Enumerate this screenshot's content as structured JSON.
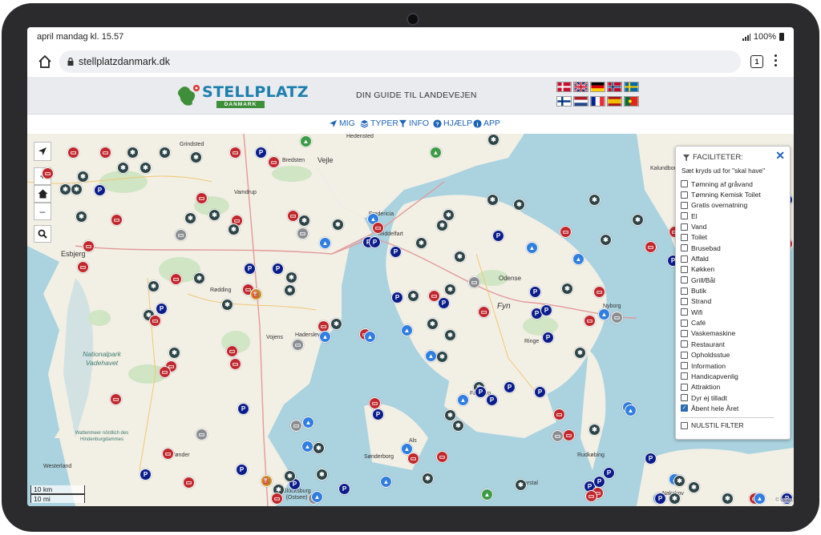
{
  "status": {
    "time": "april mandag kl. 15.57",
    "battery": "100%"
  },
  "browser": {
    "url": "stellplatzdanmark.dk",
    "tab_count": "1"
  },
  "site": {
    "logo_text": "STELLPLATZ",
    "logo_sub": "DANMARK",
    "tagline": "DIN GUIDE TIL LANDEVEJEN"
  },
  "nav": {
    "items": [
      "MIG",
      "TYPER",
      "INFO",
      "HJÆLP",
      "APP"
    ]
  },
  "map": {
    "labels": [
      "Grindsted",
      "Bredsten",
      "Vejle",
      "Fredericia",
      "Esbjerg",
      "Rødding",
      "Odense",
      "Fyn",
      "Nyborg",
      "Vojens",
      "Haderslev",
      "Nationalpark Vadehavet",
      "Wattenmeer nördlich des Hindenburgdammes",
      "Ringe",
      "Faaborg",
      "Als",
      "Sønderborg",
      "Marstal",
      "Rudkøbing",
      "Westerland",
      "Tønder",
      "Glücksburg (Ostsee)",
      "Kalundborg",
      "Nakskov",
      "Hedensted",
      "Vamdrup",
      "Middelfart"
    ],
    "scale": [
      "10 km",
      "10 mi"
    ],
    "attribution": "© OACI"
  },
  "filter": {
    "title": "FACILITETER:",
    "hint": "Sæt kryds ud for \"skal have\"",
    "items": [
      {
        "label": "Tømning af gråvand",
        "checked": false
      },
      {
        "label": "Tømning Kemisk Toilet",
        "checked": false
      },
      {
        "label": "Gratis overnatning",
        "checked": false
      },
      {
        "label": "El",
        "checked": false
      },
      {
        "label": "Vand",
        "checked": false
      },
      {
        "label": "Toilet",
        "checked": false
      },
      {
        "label": "Brusebad",
        "checked": false
      },
      {
        "label": "Affald",
        "checked": false
      },
      {
        "label": "Køkken",
        "checked": false
      },
      {
        "label": "Grill/Bål",
        "checked": false
      },
      {
        "label": "Butik",
        "checked": false
      },
      {
        "label": "Strand",
        "checked": false
      },
      {
        "label": "Wifi",
        "checked": false
      },
      {
        "label": "Café",
        "checked": false
      },
      {
        "label": "Vaskemaskine",
        "checked": false
      },
      {
        "label": "Restaurant",
        "checked": false
      },
      {
        "label": "Opholdsstue",
        "checked": false
      },
      {
        "label": "Information",
        "checked": false
      },
      {
        "label": "Handicapvenlig",
        "checked": false
      },
      {
        "label": "Attraktion",
        "checked": false
      },
      {
        "label": "Dyr ej tilladt",
        "checked": false
      },
      {
        "label": "Åbent hele Året",
        "checked": true
      }
    ],
    "reset": "NULSTIL FILTER"
  },
  "colors": {
    "accent": "#1e63b6",
    "brand": "#1c7fae",
    "water": "#aad3df",
    "land": "#f2efe5",
    "forest": "#cde4c0"
  }
}
